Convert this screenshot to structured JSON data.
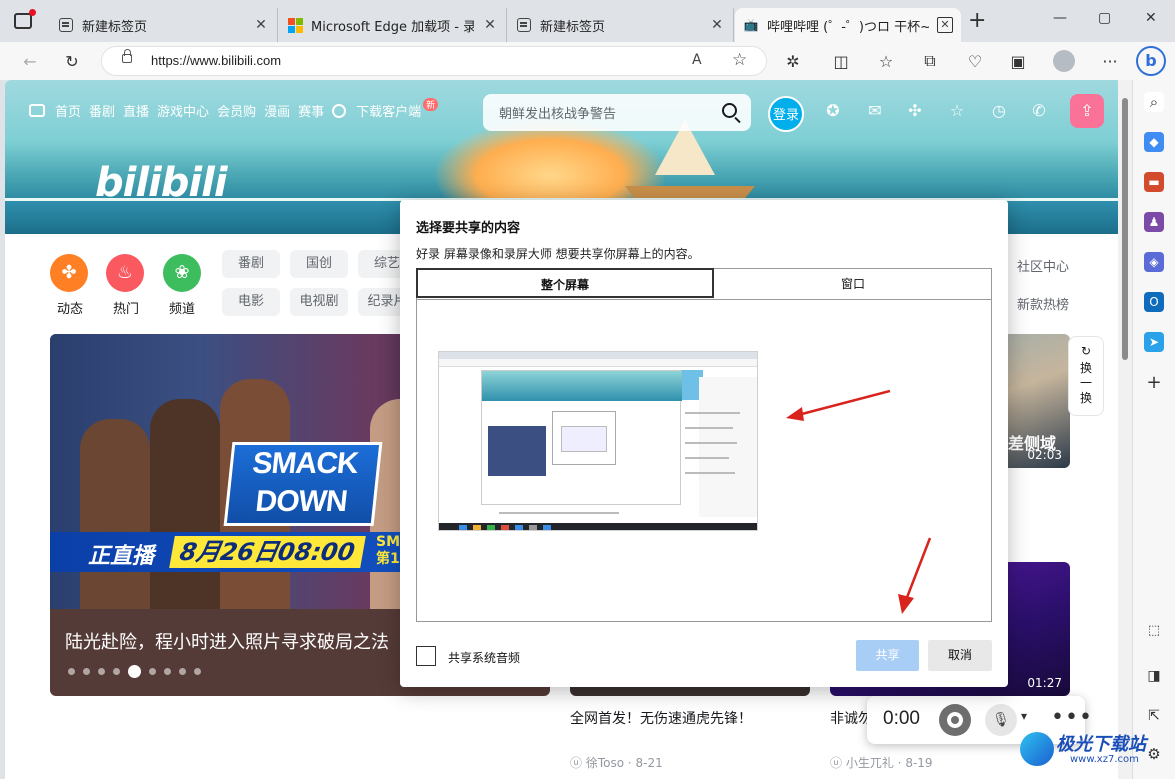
{
  "browser": {
    "tabs": [
      {
        "title": "新建标签页",
        "icon": "new-tab-icon"
      },
      {
        "title": "Microsoft Edge 加载项 - 录屏",
        "icon": "microsoft-logo-icon"
      },
      {
        "title": "新建标签页",
        "icon": "new-tab-icon"
      },
      {
        "title": "哔哩哔哩 (゜-゜)つロ 干杯~-bi",
        "icon": "bilibili-tv-icon"
      }
    ],
    "new_tab": "+",
    "close": "✕",
    "address_url": "https://www.bilibili.com",
    "read_aloud": "A",
    "window_controls": {
      "minimize": "—",
      "maximize": "▢",
      "close": "✕"
    },
    "more": "···",
    "bing": "b"
  },
  "bilibili": {
    "nav": [
      "首页",
      "番剧",
      "直播",
      "游戏中心",
      "会员购",
      "漫画",
      "赛事",
      "下载客户端"
    ],
    "nav_badge": "新",
    "logo": "bilibili",
    "search_placeholder": "朝鲜发出核战争警告",
    "login": "登录",
    "channels": [
      {
        "label": "动态",
        "color": "#ff7f24",
        "icon": "pinwheel-icon"
      },
      {
        "label": "热门",
        "color": "#f9595f",
        "icon": "flame-icon"
      },
      {
        "label": "频道",
        "color": "#3dbd5d",
        "icon": "channel-icon"
      }
    ],
    "pills_row1": [
      "番剧",
      "国创",
      "综艺"
    ],
    "pills_row2": [
      "电影",
      "电视剧",
      "纪录片"
    ],
    "side_links": [
      "社区中心",
      "新款热榜"
    ],
    "carousel": {
      "caption": "陆光赴险，程小时进入照片寻求破局之法",
      "smack_line1": "SMACK",
      "smack_line2": "DOWN",
      "live_label": "正直播",
      "live_date": "8月26日08:00",
      "live_side1": "SM",
      "live_side2": "第1",
      "dots_total": 9,
      "dots_active": 5
    },
    "refresh_label": "换一换",
    "videos": [
      {
        "title": "全网首发！无伤速通虎先锋！",
        "author": "徐Toso",
        "date": "8-21",
        "duration": ""
      },
      {
        "title": "非诚勿",
        "author": "小生兀礼",
        "date": "8-19",
        "duration": "01:27"
      }
    ],
    "top_right_duration": "02:03",
    "top_right_caption": "差侧域"
  },
  "dialog": {
    "title": "选择要共享的内容",
    "subtitle": "好录 屏幕录像和录屏大师 想要共享你屏幕上的内容。",
    "tab_screen": "整个屏幕",
    "tab_window": "窗口",
    "checkbox_label": "共享系统音频",
    "share": "共享",
    "cancel": "取消"
  },
  "recorder": {
    "time": "0:00"
  },
  "watermark": {
    "name": "极光下载站",
    "url": "www.xz7.com"
  },
  "colors": {
    "accent_blue": "#00aeec",
    "pink": "#fb7299",
    "share_disabled": "#a9cef5",
    "arrow_red": "#d9231d"
  }
}
